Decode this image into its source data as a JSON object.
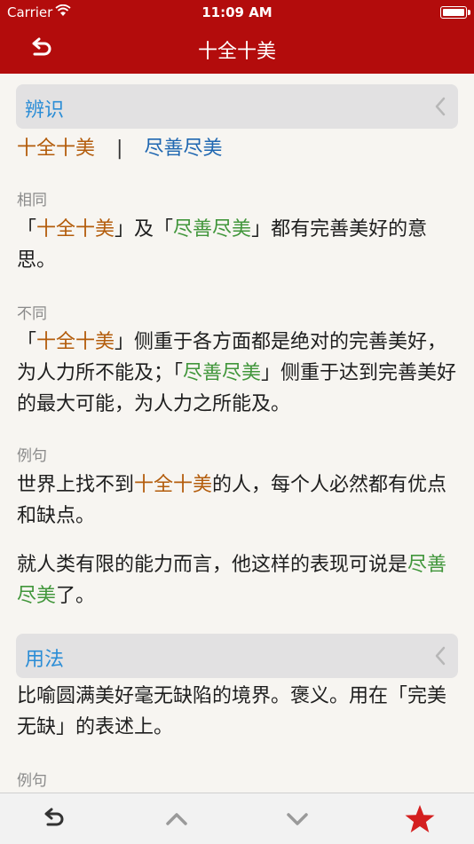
{
  "status": {
    "carrier": "Carrier",
    "time": "11:09 AM"
  },
  "nav": {
    "title": "十全十美"
  },
  "section1": {
    "title": "辨识",
    "tabs": [
      "十全十美",
      "|",
      "尽善尽美"
    ],
    "same": {
      "label": "相同",
      "parts": [
        "「",
        "十全十美",
        "」及「",
        "尽善尽美",
        "」都有完善美好的意思。"
      ]
    },
    "diff": {
      "label": "不同",
      "parts": [
        "「",
        "十全十美",
        "」侧重于各方面都是绝对的完善美好，为人力所不能及；「",
        "尽善尽美",
        "」侧重于达到完善美好的最大可能，为人力之所能及。"
      ]
    },
    "examples": {
      "label": "例句",
      "ex1": [
        "世界上找不到",
        "十全十美",
        "的人，每个人必然都有优点和缺点。"
      ],
      "ex2": [
        "就人类有限的能力而言，他这样的表现可说是",
        "尽善尽美",
        "了。"
      ]
    }
  },
  "section2": {
    "title": "用法",
    "text": "比喻圆满美好毫无缺陷的境界。褒义。用在「完美无缺」的表述上。",
    "label": "例句"
  },
  "toolbar": {
    "icons": [
      "back-arrow-icon",
      "chevron-up-icon",
      "chevron-down-icon",
      "star-icon"
    ]
  },
  "colors": {
    "brand": "#b30c0c",
    "accent_orange": "#b35c0b",
    "accent_green": "#41963b",
    "link_blue": "#1f67b1",
    "header_blue": "#2b8dd6",
    "star": "#d41f1f"
  }
}
